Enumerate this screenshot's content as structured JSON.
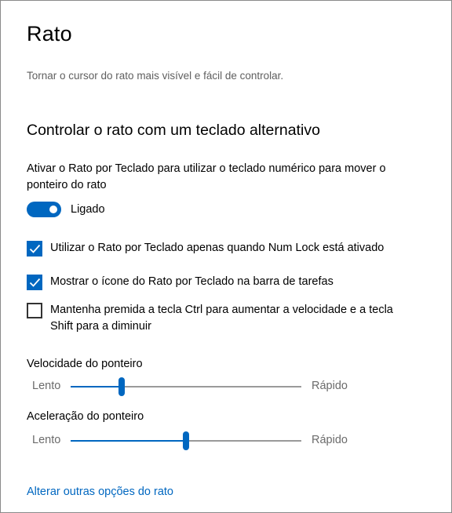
{
  "page": {
    "title": "Rato",
    "description": "Tornar o cursor do rato mais visível e fácil de controlar."
  },
  "section": {
    "title": "Controlar o rato com um teclado alternativo"
  },
  "mouse_keys": {
    "description": "Ativar o Rato por Teclado para utilizar o teclado numérico para mover o ponteiro do rato",
    "toggle_state": true,
    "toggle_label": "Ligado"
  },
  "checkboxes": [
    {
      "label": "Utilizar o Rato por Teclado apenas quando Num Lock está ativado",
      "checked": true
    },
    {
      "label": "Mostrar o ícone do Rato por Teclado na barra de tarefas",
      "checked": true
    },
    {
      "label": "Mantenha premida a tecla Ctrl para aumentar a velocidade e a tecla Shift para a diminuir",
      "checked": false
    }
  ],
  "sliders": {
    "speed": {
      "title": "Velocidade do ponteiro",
      "min_label": "Lento",
      "max_label": "Rápido",
      "value_fraction": 0.22
    },
    "acceleration": {
      "title": "Aceleração do ponteiro",
      "min_label": "Lento",
      "max_label": "Rápido",
      "value_fraction": 0.5
    }
  },
  "link": {
    "label": "Alterar outras opções do rato"
  },
  "colors": {
    "accent": "#0067c0",
    "track": "#9a9a9a",
    "secondary_text": "#5f5f5f"
  },
  "icons": {
    "checkmark": "checkmark-icon"
  }
}
